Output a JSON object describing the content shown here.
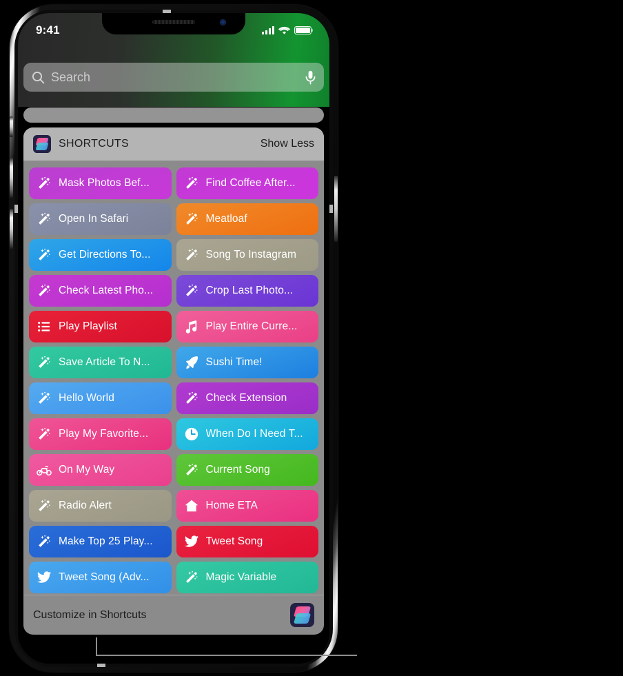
{
  "status_bar": {
    "time": "9:41",
    "signal_icon": "cellular-bars-icon",
    "wifi_icon": "wifi-icon",
    "battery_icon": "battery-full-icon"
  },
  "search": {
    "placeholder": "Search",
    "search_icon": "search-icon",
    "mic_icon": "microphone-icon"
  },
  "widget": {
    "title": "SHORTCUTS",
    "show_less_label": "Show Less",
    "app_icon": "shortcuts-app-icon",
    "footer_label": "Customize in Shortcuts",
    "footer_icon": "shortcuts-app-icon"
  },
  "colors": {
    "widget_background": "#969696",
    "widget_header": "#bababa",
    "accent_green": "#13943 0"
  },
  "tiles": [
    {
      "label": "Mask Photos Bef...",
      "icon": "magic-wand-icon",
      "color_start": "#b93fd0",
      "color_end": "#c838d8"
    },
    {
      "label": "Find Coffee After...",
      "icon": "magic-wand-icon",
      "color_start": "#c23ad4",
      "color_end": "#cc35dd"
    },
    {
      "label": "Open In Safari",
      "icon": "magic-wand-icon",
      "color_start": "#8a91ab",
      "color_end": "#7b8299"
    },
    {
      "label": "Meatloaf",
      "icon": "magic-wand-icon",
      "color_start": "#f08a2a",
      "color_end": "#ef6f10"
    },
    {
      "label": "Get Directions To...",
      "icon": "magic-wand-icon",
      "color_start": "#2fa6e8",
      "color_end": "#1486ea"
    },
    {
      "label": "Song To Instagram",
      "icon": "magic-wand-icon",
      "color_start": "#a9a592",
      "color_end": "#9d9a86"
    },
    {
      "label": "Check Latest Pho...",
      "icon": "magic-wand-icon",
      "color_start": "#c53ad0",
      "color_end": "#b52fd0"
    },
    {
      "label": "Crop Last Photo...",
      "icon": "magic-wand-icon",
      "color_start": "#7c4bd8",
      "color_end": "#6a34d4"
    },
    {
      "label": "Play Playlist",
      "icon": "playlist-icon",
      "color_start": "#e82238",
      "color_end": "#d8102c"
    },
    {
      "label": "Play Entire Curre...",
      "icon": "music-note-icon",
      "color_start": "#f0609a",
      "color_end": "#ea3f86"
    },
    {
      "label": "Save Article To N...",
      "icon": "magic-wand-icon",
      "color_start": "#33c9a0",
      "color_end": "#20b894"
    },
    {
      "label": "Sushi Time!",
      "icon": "rocket-icon",
      "color_start": "#40a8ea",
      "color_end": "#1d7fe0"
    },
    {
      "label": "Hello World",
      "icon": "magic-wand-icon",
      "color_start": "#55aaf0",
      "color_end": "#3a91ea"
    },
    {
      "label": "Check Extension",
      "icon": "magic-wand-icon",
      "color_start": "#b13ad0",
      "color_end": "#9a2ec8"
    },
    {
      "label": "Play My Favorite...",
      "icon": "magic-wand-icon",
      "color_start": "#ef5596",
      "color_end": "#e8317e"
    },
    {
      "label": "When Do I Need T...",
      "icon": "clock-icon",
      "color_start": "#2ec8e0",
      "color_end": "#12a8dd"
    },
    {
      "label": "On My Way",
      "icon": "motorcycle-icon",
      "color_start": "#ef5aa0",
      "color_end": "#ea3f8c"
    },
    {
      "label": "Current Song",
      "icon": "magic-wand-icon",
      "color_start": "#5fc63a",
      "color_end": "#44b81e"
    },
    {
      "label": "Radio Alert",
      "icon": "magic-wand-icon",
      "color_start": "#a9a592",
      "color_end": "#9a9784"
    },
    {
      "label": "Home ETA",
      "icon": "house-icon",
      "color_start": "#ef4f95",
      "color_end": "#ea3080"
    },
    {
      "label": "Make Top 25 Play...",
      "icon": "magic-wand-icon",
      "color_start": "#2a6ed8",
      "color_end": "#1a57cc"
    },
    {
      "label": "Tweet Song",
      "icon": "twitter-bird-icon",
      "color_start": "#ea2240",
      "color_end": "#df0f32"
    },
    {
      "label": "Tweet Song (Adv...",
      "icon": "twitter-bird-icon",
      "color_start": "#4aa8ee",
      "color_end": "#3190e8"
    },
    {
      "label": "Magic Variable",
      "icon": "magic-wand-icon",
      "color_start": "#35c9a4",
      "color_end": "#22b896"
    }
  ]
}
